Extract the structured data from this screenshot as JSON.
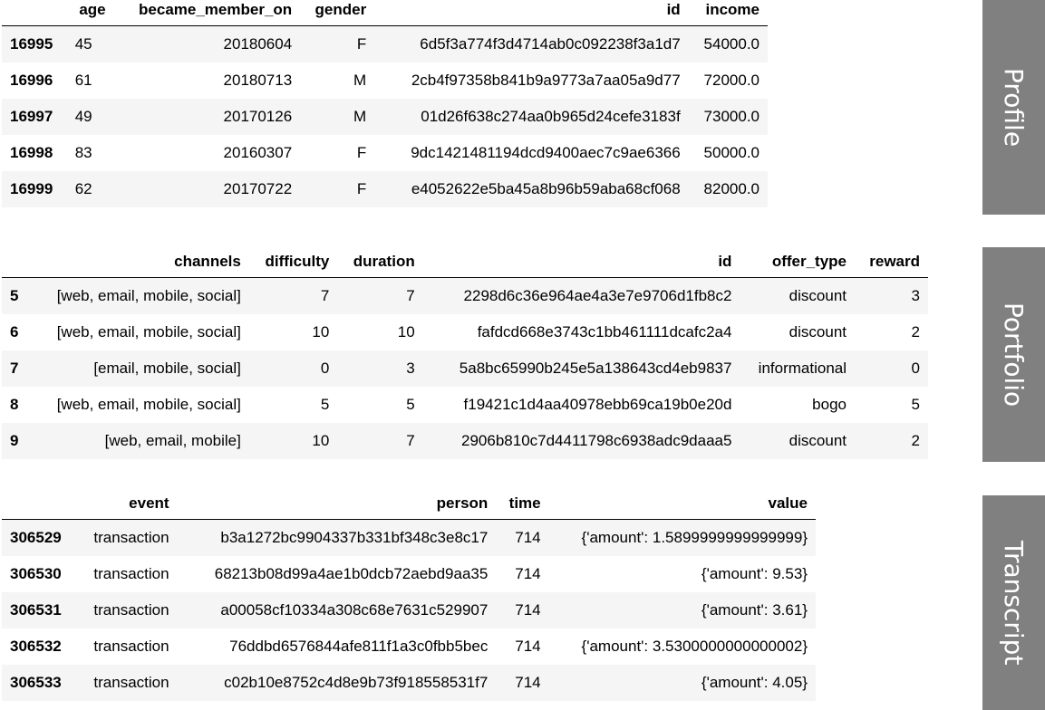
{
  "profile": {
    "columns": [
      "",
      "age",
      "became_member_on",
      "gender",
      "id",
      "income"
    ],
    "rows": [
      [
        "16995",
        "45",
        "20180604",
        "F",
        "6d5f3a774f3d4714ab0c092238f3a1d7",
        "54000.0"
      ],
      [
        "16996",
        "61",
        "20180713",
        "M",
        "2cb4f97358b841b9a9773a7aa05a9d77",
        "72000.0"
      ],
      [
        "16997",
        "49",
        "20170126",
        "M",
        "01d26f638c274aa0b965d24cefe3183f",
        "73000.0"
      ],
      [
        "16998",
        "83",
        "20160307",
        "F",
        "9dc1421481194dcd9400aec7c9ae6366",
        "50000.0"
      ],
      [
        "16999",
        "62",
        "20170722",
        "F",
        "e4052622e5ba45a8b96b59aba68cf068",
        "82000.0"
      ]
    ]
  },
  "portfolio": {
    "columns": [
      "",
      "channels",
      "difficulty",
      "duration",
      "id",
      "offer_type",
      "reward"
    ],
    "rows": [
      [
        "5",
        "[web, email, mobile, social]",
        "7",
        "7",
        "2298d6c36e964ae4a3e7e9706d1fb8c2",
        "discount",
        "3"
      ],
      [
        "6",
        "[web, email, mobile, social]",
        "10",
        "10",
        "fafdcd668e3743c1bb461111dcafc2a4",
        "discount",
        "2"
      ],
      [
        "7",
        "[email, mobile, social]",
        "0",
        "3",
        "5a8bc65990b245e5a138643cd4eb9837",
        "informational",
        "0"
      ],
      [
        "8",
        "[web, email, mobile, social]",
        "5",
        "5",
        "f19421c1d4aa40978ebb69ca19b0e20d",
        "bogo",
        "5"
      ],
      [
        "9",
        "[web, email, mobile]",
        "10",
        "7",
        "2906b810c7d4411798c6938adc9daaa5",
        "discount",
        "2"
      ]
    ]
  },
  "transcript": {
    "columns": [
      "",
      "event",
      "person",
      "time",
      "value"
    ],
    "rows": [
      [
        "306529",
        "transaction",
        "b3a1272bc9904337b331bf348c3e8c17",
        "714",
        "{'amount': 1.5899999999999999}"
      ],
      [
        "306530",
        "transaction",
        "68213b08d99a4ae1b0dcb72aebd9aa35",
        "714",
        "{'amount': 9.53}"
      ],
      [
        "306531",
        "transaction",
        "a00058cf10334a308c68e7631c529907",
        "714",
        "{'amount': 3.61}"
      ],
      [
        "306532",
        "transaction",
        "76ddbd6576844afe811f1a3c0fbb5bec",
        "714",
        "{'amount': 3.5300000000000002}"
      ],
      [
        "306533",
        "transaction",
        "c02b10e8752c4d8e9b73f918558531f7",
        "714",
        "{'amount': 4.05}"
      ]
    ]
  },
  "side_labels": {
    "profile": "Profile",
    "portfolio": "Portfolio",
    "transcript": "Transcript"
  }
}
